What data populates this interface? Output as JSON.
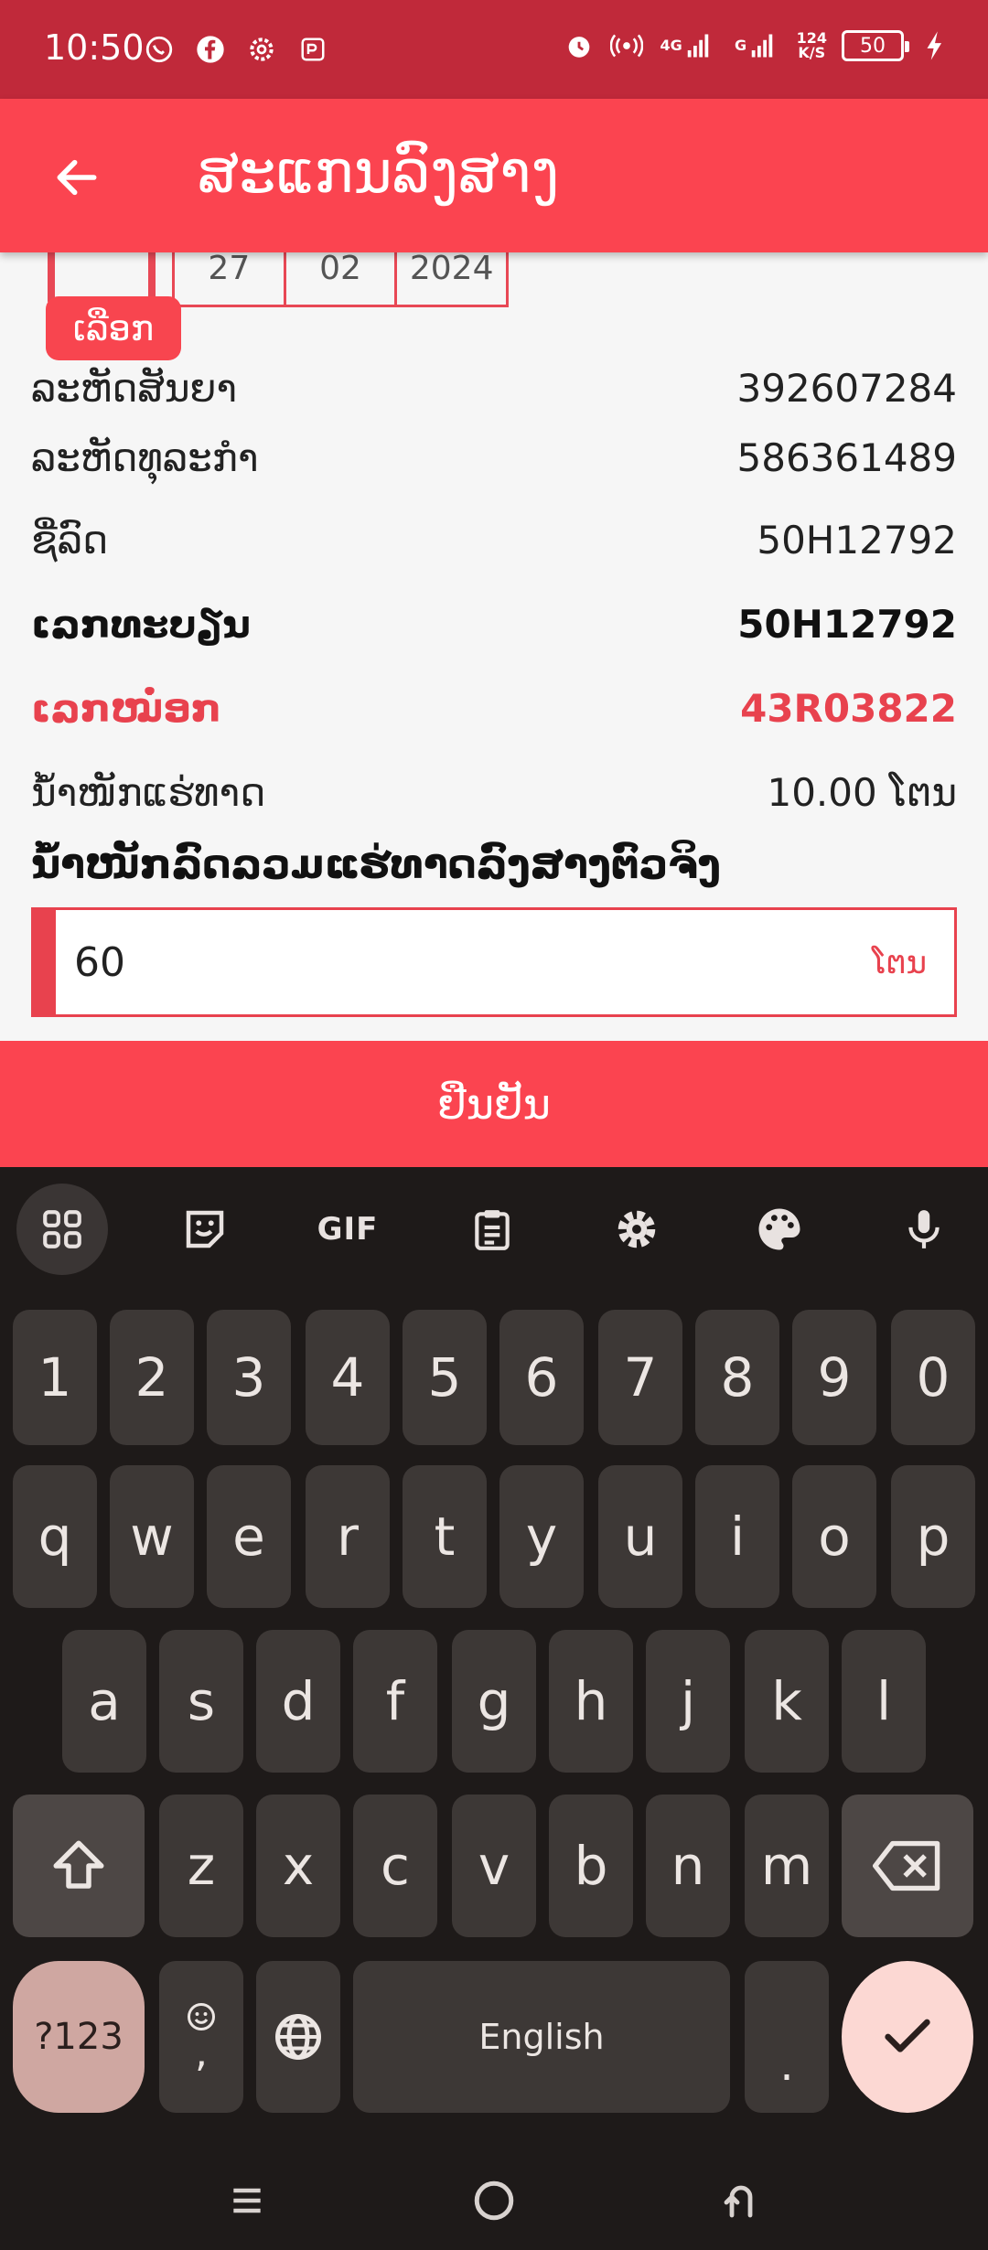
{
  "status_bar": {
    "time": "10:50",
    "left_icons": [
      "whatsapp-icon",
      "facebook-icon",
      "settings-gear-icon",
      "app-icon"
    ],
    "right_icons": [
      "alarm-icon",
      "hotspot-icon",
      "signal-4g-icon",
      "signal-g-icon"
    ],
    "net_speed_top": "124",
    "net_speed_bottom": "K/S",
    "net_4g": "4G",
    "net_g": "G",
    "battery": "50"
  },
  "app_bar": {
    "title": "ສະແກນລົງສາງ",
    "back_icon": "arrow-left-icon"
  },
  "date_selector": {
    "day": "27",
    "month": "02",
    "year": "2024",
    "select_label": "ເລືອກ"
  },
  "details": [
    {
      "label": "ລະຫັດສັນຍາ",
      "value": "392607284",
      "style": "normal"
    },
    {
      "label": "ລະຫັດທຸລະກຳ",
      "value": "586361489",
      "style": "normal"
    },
    {
      "label": "ຊື່ລົດ",
      "value": "50H12792",
      "style": "normal"
    },
    {
      "label": "ເລກທະບຽນ",
      "value": "50H12792",
      "style": "bold"
    },
    {
      "label": "ເລກໝໍ່ອກ",
      "value": "43R03822",
      "style": "red"
    },
    {
      "label": "ນ້ຳໜັກແຮ່ທາດ",
      "value": "10.00 ໂຕນ",
      "style": "normal"
    }
  ],
  "weight_field": {
    "label": "ນ້ຳໜັກລົດລວມແຮ່ທາດລົງສາງຕົວຈິງ",
    "value": "60",
    "unit": "ໂຕນ"
  },
  "confirm_label": "ຢືນຢັນ",
  "keyboard": {
    "toolbar": [
      "apps-grid-icon",
      "sticker-icon",
      "GIF",
      "clipboard-icon",
      "settings-icon",
      "palette-icon",
      "microphone-icon"
    ],
    "gif_label": "GIF",
    "row_numbers": [
      "1",
      "2",
      "3",
      "4",
      "5",
      "6",
      "7",
      "8",
      "9",
      "0"
    ],
    "row_top": [
      "q",
      "w",
      "e",
      "r",
      "t",
      "y",
      "u",
      "i",
      "o",
      "p"
    ],
    "row_middle": [
      "a",
      "s",
      "d",
      "f",
      "g",
      "h",
      "j",
      "k",
      "l"
    ],
    "row_bottom": [
      "z",
      "x",
      "c",
      "v",
      "b",
      "n",
      "m"
    ],
    "symbols_label": "?123",
    "comma_label": ",",
    "space_label": "English",
    "period_label": "."
  },
  "colors": {
    "status_bar": "#c0293a",
    "brand_red": "#fb4450",
    "accent_red": "#e8424e",
    "keyboard_bg": "#1e1a19",
    "key_bg": "#3d3836"
  }
}
